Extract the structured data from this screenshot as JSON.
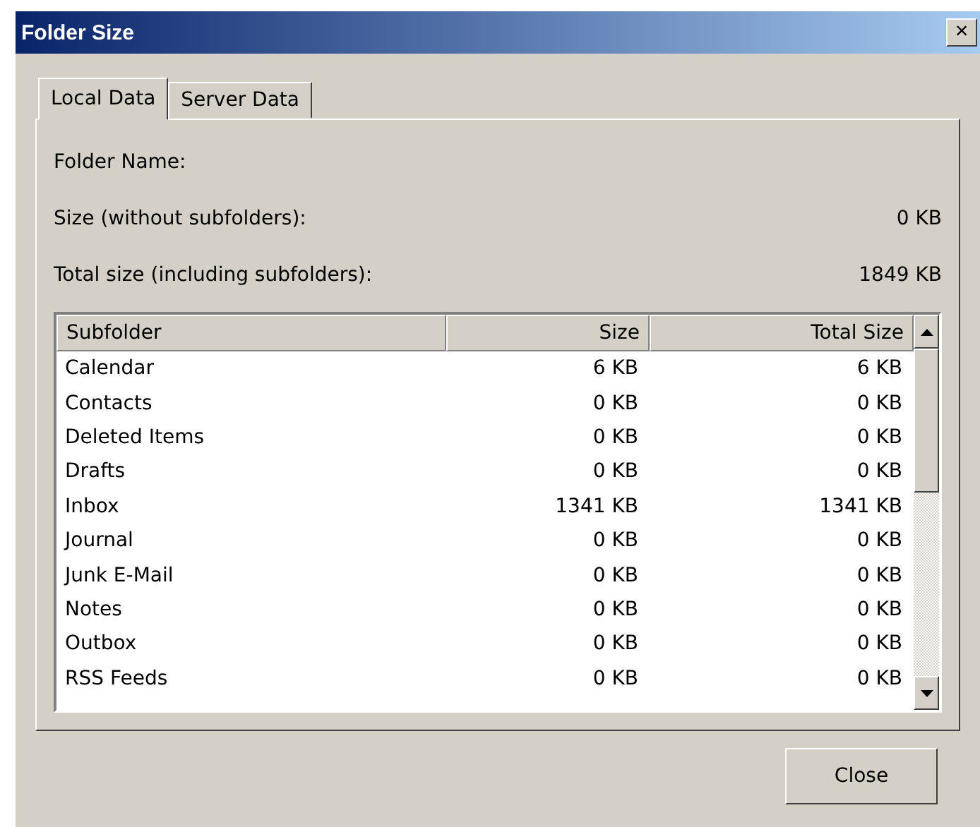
{
  "window": {
    "title": "Folder Size",
    "close": "×"
  },
  "tabs": [
    {
      "label": "Local Data",
      "selected": true
    },
    {
      "label": "Server Data",
      "selected": false
    }
  ],
  "fields": [
    {
      "label": "Folder Name:"
    },
    {
      "label": "Size (without subfolders):",
      "value": "0 KB"
    },
    {
      "label": "Total size (including subfolders):",
      "value": "1849 KB"
    }
  ],
  "table": {
    "columns": [
      "Subfolder",
      "Size",
      "Total Size"
    ],
    "rows": [
      [
        "Calendar",
        "6 KB",
        "6 KB"
      ],
      [
        "Contacts",
        "0 KB",
        "0 KB"
      ],
      [
        "Deleted Items",
        "0 KB",
        "0 KB"
      ],
      [
        "Drafts",
        "0 KB",
        "0 KB"
      ],
      [
        "Inbox",
        "1341 KB",
        "1341 KB"
      ],
      [
        "Journal",
        "0 KB",
        "0 KB"
      ],
      [
        "Junk E-Mail",
        "0 KB",
        "0 KB"
      ],
      [
        "Notes",
        "0 KB",
        "0 KB"
      ],
      [
        "Outbox",
        "0 KB",
        "0 KB"
      ],
      [
        "RSS Feeds",
        "0 KB",
        "0 KB"
      ]
    ]
  },
  "buttons": [
    "Close"
  ]
}
